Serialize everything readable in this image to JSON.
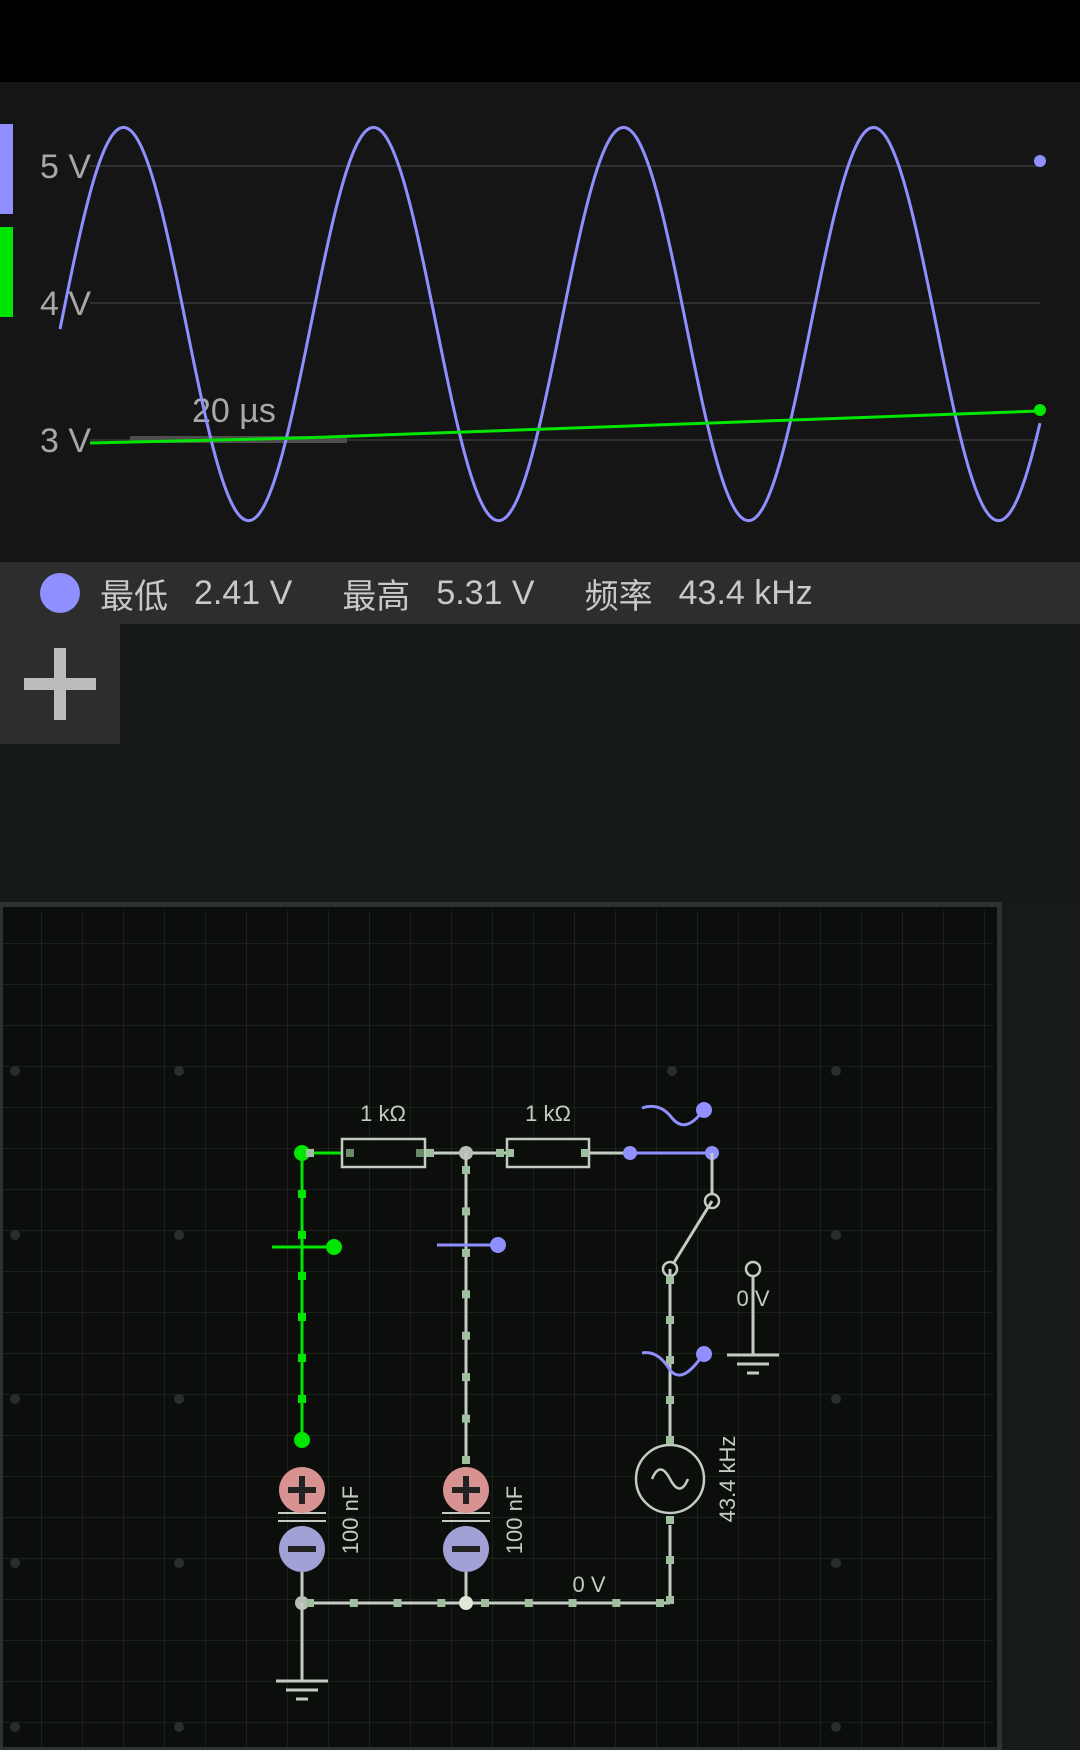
{
  "scope": {
    "y_axis": {
      "ticks": [
        "5 V",
        "4 V",
        "3 V"
      ]
    },
    "time_scale_label": "20 µs",
    "channels": [
      {
        "color": "#8f8fff"
      },
      {
        "color": "#00e600"
      }
    ]
  },
  "chart_data": {
    "type": "line",
    "yunits": "V",
    "ylim": [
      2.4,
      5.35
    ],
    "yticks": [
      "5 V",
      "4 V",
      "3 V"
    ],
    "grid": true,
    "scale_bar": "20 µs",
    "series": [
      {
        "color": "#8f8fff",
        "shape": "sine",
        "min": 2.41,
        "max": 5.31,
        "frequency": "43.4 kHz"
      },
      {
        "color": "#00e600",
        "shape": "rising",
        "start": 3.0,
        "end": 3.23
      }
    ]
  },
  "stats": {
    "channel_color": "#8f8fff",
    "min_label": "最低",
    "min_value": "2.41 V",
    "max_label": "最高",
    "max_value": "5.31 V",
    "freq_label": "频率",
    "freq_value": "43.4 kHz"
  },
  "toolbar": {
    "add_icon": "plus-icon"
  },
  "circuit": {
    "resistor1_label": "1 kΩ",
    "resistor2_label": "1 kΩ",
    "capacitor1_label": "100 nF",
    "capacitor2_label": "100 nF",
    "source_label": "43.4 kHz",
    "ground_voltage_label": "0 V",
    "bottom_wire_voltage_label": "0 V",
    "colors": {
      "green": "#00e600",
      "purple": "#8f8fff",
      "wire": "#c3ccc3",
      "cap_plus": "#d99292",
      "cap_minus": "#a1a1d6"
    }
  }
}
